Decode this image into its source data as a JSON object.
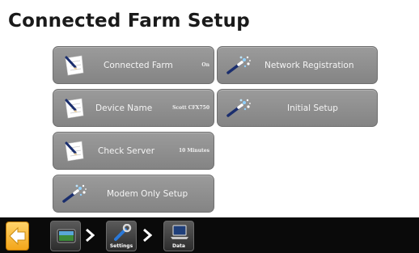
{
  "page": {
    "title": "Connected Farm Setup"
  },
  "tiles": {
    "connected_farm": {
      "label": "Connected Farm",
      "value": "On"
    },
    "network_registration": {
      "label": "Network Registration"
    },
    "device_name": {
      "label": "Device Name",
      "value": "Scott CFX750"
    },
    "initial_setup": {
      "label": "Initial Setup"
    },
    "check_server": {
      "label": "Check Server",
      "value": "10 Minutes"
    },
    "modem_only_setup": {
      "label": "Modem Only Setup"
    }
  },
  "breadcrumb": {
    "settings_label": "Settings",
    "data_label": "Data"
  },
  "icons": {
    "tile_edit": "notepad-pencil-icon",
    "tile_wizard": "magic-wand-icon",
    "back": "back-arrow-icon",
    "home": "display-home-icon",
    "settings": "wrench-icon",
    "data": "laptop-icon",
    "separator": "chevron-right-icon"
  },
  "colors": {
    "tile_bg": "#8e8e8e",
    "back_button": "#f6b02c",
    "bottom_bar": "#0a0a0a",
    "title_text": "#1a1a1a"
  }
}
